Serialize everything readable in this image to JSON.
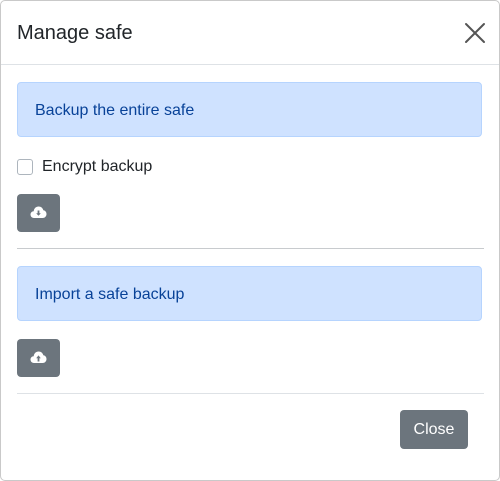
{
  "modal": {
    "title": "Manage safe"
  },
  "backup": {
    "alert_text": "Backup the entire safe",
    "encrypt_label": "Encrypt backup",
    "encrypt_checked": false,
    "button_icon": "cloud-download-icon"
  },
  "import": {
    "alert_text": "Import a safe backup",
    "button_icon": "cloud-upload-icon"
  },
  "footer": {
    "close_label": "Close"
  },
  "colors": {
    "alert_bg": "#cfe2ff",
    "alert_text": "#084298",
    "secondary_button": "#6c757d"
  }
}
